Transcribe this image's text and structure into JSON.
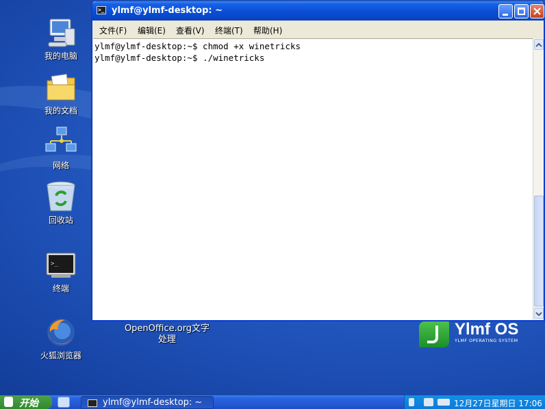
{
  "desktop": {
    "icons": [
      {
        "label": "我的电脑",
        "icon": "computer-icon"
      },
      {
        "label": "我的文档",
        "icon": "documents-folder-icon"
      },
      {
        "label": "网络",
        "icon": "network-icon"
      },
      {
        "label": "回收站",
        "icon": "recycle-bin-icon"
      },
      {
        "label": "终端",
        "icon": "terminal-icon"
      },
      {
        "label": "火狐浏览器",
        "icon": "firefox-icon"
      }
    ],
    "openoffice_label": "OpenOffice.org文字处理",
    "logo": {
      "name": "Ylmf OS",
      "subtitle": "YLMF OPERATING SYSTEM",
      "color": "#2aa03a"
    }
  },
  "window": {
    "title": "ylmf@ylmf-desktop: ~",
    "menu": [
      "文件(F)",
      "编辑(E)",
      "查看(V)",
      "终端(T)",
      "帮助(H)"
    ],
    "terminal_lines": [
      "ylmf@ylmf-desktop:~$ chmod +x winetricks",
      "ylmf@ylmf-desktop:~$ ./winetricks"
    ]
  },
  "taskbar": {
    "start_label": "开始",
    "task_label": "ylmf@ylmf-desktop: ~",
    "clock": "12月27日星期日 17:06"
  },
  "colors": {
    "titlebar": "#0a50d8",
    "taskbar": "#2458d4",
    "start": "#2f8a2c",
    "tray": "#0c7ad8"
  }
}
